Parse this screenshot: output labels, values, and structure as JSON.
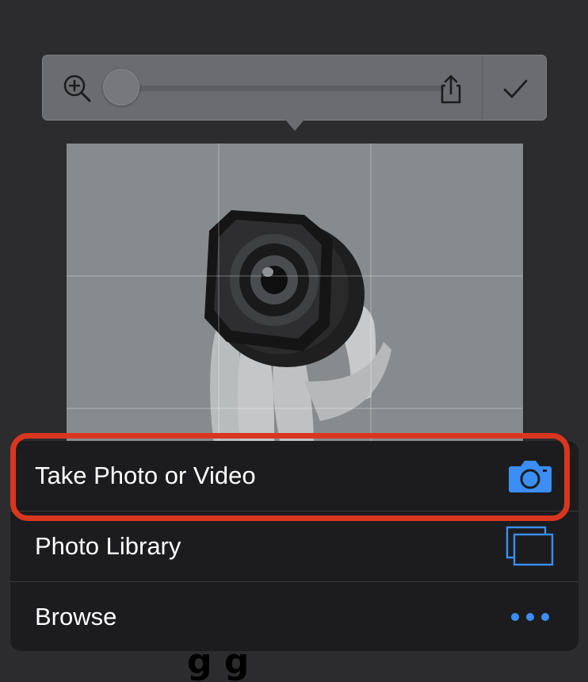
{
  "toolbar": {
    "zoom_icon": "zoom-in-icon",
    "zoom_level": 0,
    "share_icon": "share-icon",
    "confirm_icon": "checkmark-icon"
  },
  "photo": {
    "icon": "photo-camera-lens-image",
    "description_visible": false
  },
  "action_sheet": {
    "items": [
      {
        "label": "Take Photo or Video",
        "icon": "camera-icon",
        "highlighted": true
      },
      {
        "label": "Photo Library",
        "icon": "photo-library-icon",
        "highlighted": false
      },
      {
        "label": "Browse",
        "icon": "more-icon",
        "highlighted": false
      }
    ]
  },
  "colors": {
    "accent": "#3a8ef6",
    "highlight": "#d9361f",
    "sheet_background": "#1c1c1e",
    "page_background": "#2c2c2e"
  }
}
